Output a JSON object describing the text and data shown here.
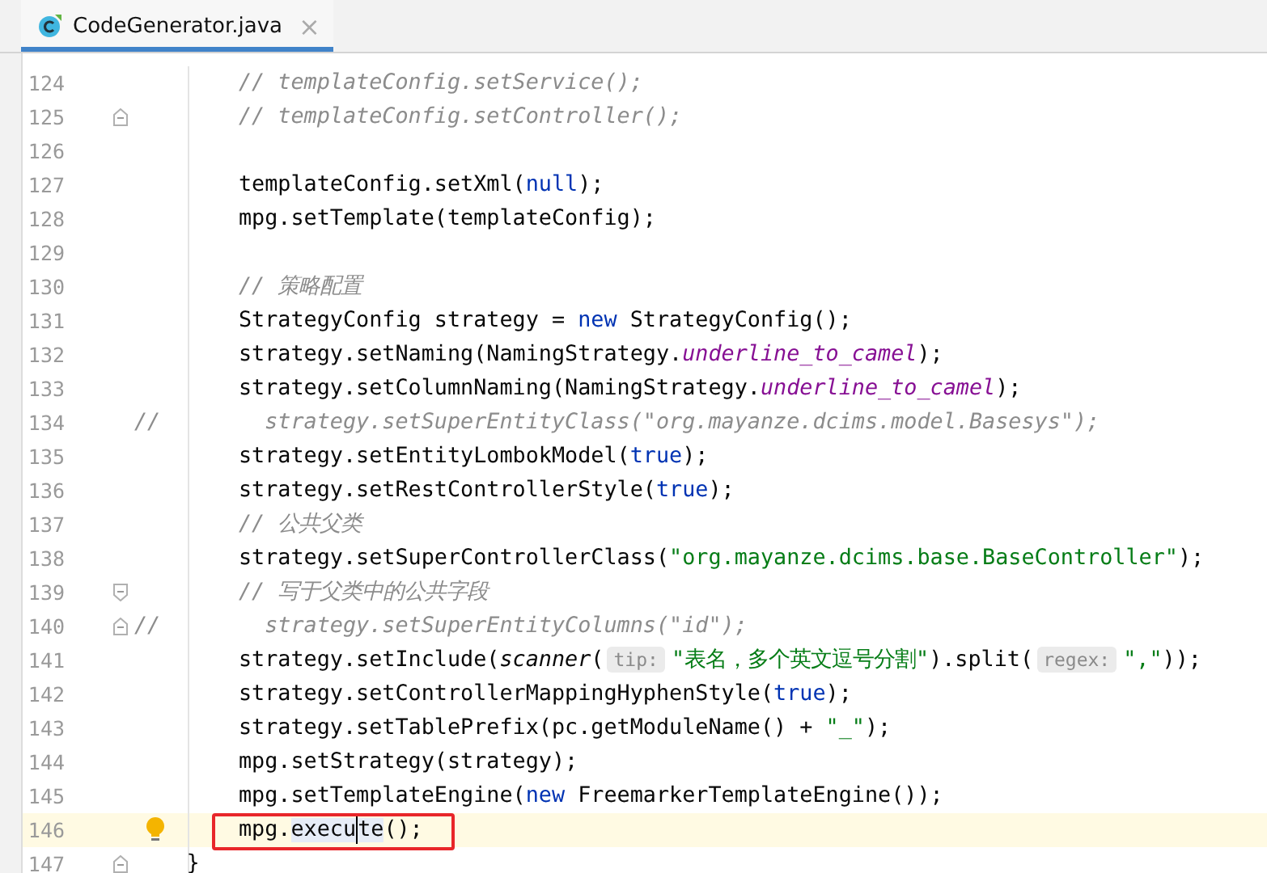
{
  "tab": {
    "title": "CodeGenerator.java",
    "selected": true,
    "close_glyph": "×"
  },
  "lines": [
    {
      "number": "124",
      "segments": [
        {
          "kind": "comment",
          "text": "        // templateConfig.setService();"
        }
      ]
    },
    {
      "number": "125",
      "fold_close": true,
      "segments": [
        {
          "kind": "comment",
          "text": "        // templateConfig.setController();"
        }
      ]
    },
    {
      "number": "126"
    },
    {
      "number": "127",
      "segments": [
        {
          "kind": "plain",
          "text": "        templateConfig.setXml("
        },
        {
          "kind": "keyword",
          "text": "null"
        },
        {
          "kind": "plain",
          "text": ");"
        }
      ]
    },
    {
      "number": "128",
      "segments": [
        {
          "kind": "plain",
          "text": "        mpg.setTemplate(templateConfig);"
        }
      ]
    },
    {
      "number": "129"
    },
    {
      "number": "130",
      "segments": [
        {
          "kind": "comment",
          "text": "        // 策略配置"
        }
      ]
    },
    {
      "number": "131",
      "segments": [
        {
          "kind": "plain",
          "text": "        StrategyConfig strategy = "
        },
        {
          "kind": "keyword",
          "text": "new"
        },
        {
          "kind": "plain",
          "text": " StrategyConfig();"
        }
      ]
    },
    {
      "number": "132",
      "segments": [
        {
          "kind": "plain",
          "text": "        strategy.setNaming(NamingStrategy."
        },
        {
          "kind": "static",
          "text": "underline_to_camel"
        },
        {
          "kind": "plain",
          "text": ");"
        }
      ]
    },
    {
      "number": "133",
      "segments": [
        {
          "kind": "plain",
          "text": "        strategy.setColumnNaming(NamingStrategy."
        },
        {
          "kind": "static",
          "text": "underline_to_camel"
        },
        {
          "kind": "plain",
          "text": ");"
        }
      ]
    },
    {
      "number": "134",
      "segments": [
        {
          "kind": "comment",
          "text": "//        strategy.setSuperEntityClass(\"org.mayanze.dcims.model.Basesys\");"
        }
      ]
    },
    {
      "number": "135",
      "segments": [
        {
          "kind": "plain",
          "text": "        strategy.setEntityLombokModel("
        },
        {
          "kind": "keyword",
          "text": "true"
        },
        {
          "kind": "plain",
          "text": ");"
        }
      ]
    },
    {
      "number": "136",
      "segments": [
        {
          "kind": "plain",
          "text": "        strategy.setRestControllerStyle("
        },
        {
          "kind": "keyword",
          "text": "true"
        },
        {
          "kind": "plain",
          "text": ");"
        }
      ]
    },
    {
      "number": "137",
      "segments": [
        {
          "kind": "comment",
          "text": "        // 公共父类"
        }
      ]
    },
    {
      "number": "138",
      "segments": [
        {
          "kind": "plain",
          "text": "        strategy.setSuperControllerClass("
        },
        {
          "kind": "string",
          "text": "\"org.mayanze.dcims.base.BaseController\""
        },
        {
          "kind": "plain",
          "text": ");"
        }
      ]
    },
    {
      "number": "139",
      "fold_open": true,
      "segments": [
        {
          "kind": "comment",
          "text": "        // 写于父类中的公共字段"
        }
      ]
    },
    {
      "number": "140",
      "fold_close": true,
      "segments": [
        {
          "kind": "comment",
          "text": "//        strategy.setSuperEntityColumns(\"id\");"
        }
      ]
    },
    {
      "number": "141",
      "segments": [
        {
          "kind": "plain",
          "text": "        strategy.setInclude("
        },
        {
          "kind": "italic",
          "text": "scanner"
        },
        {
          "kind": "plain",
          "text": "("
        },
        {
          "kind": "hint",
          "text": "tip:"
        },
        {
          "kind": "string",
          "text": "\"表名，多个英文逗号分割\""
        },
        {
          "kind": "plain",
          "text": ").split("
        },
        {
          "kind": "hint",
          "text": "regex:"
        },
        {
          "kind": "string",
          "text": "\",\""
        },
        {
          "kind": "plain",
          "text": "));"
        }
      ]
    },
    {
      "number": "142",
      "segments": [
        {
          "kind": "plain",
          "text": "        strategy.setControllerMappingHyphenStyle("
        },
        {
          "kind": "keyword",
          "text": "true"
        },
        {
          "kind": "plain",
          "text": ");"
        }
      ]
    },
    {
      "number": "143",
      "segments": [
        {
          "kind": "plain",
          "text": "        strategy.setTablePrefix(pc.getModuleName() + "
        },
        {
          "kind": "string",
          "text": "\"_\""
        },
        {
          "kind": "plain",
          "text": ");"
        }
      ]
    },
    {
      "number": "144",
      "segments": [
        {
          "kind": "plain",
          "text": "        mpg.setStrategy(strategy);"
        }
      ]
    },
    {
      "number": "145",
      "segments": [
        {
          "kind": "plain",
          "text": "        mpg.setTemplateEngine("
        },
        {
          "kind": "keyword",
          "text": "new"
        },
        {
          "kind": "plain",
          "text": " FreemarkerTemplateEngine());"
        }
      ]
    },
    {
      "number": "146",
      "current": true,
      "bulb": true,
      "boxed": true,
      "segments": [
        {
          "kind": "plain",
          "text": "        mpg."
        },
        {
          "kind": "usage",
          "text": "execu"
        },
        {
          "kind": "caret"
        },
        {
          "kind": "usage",
          "text": "te"
        },
        {
          "kind": "plain",
          "text": "();"
        }
      ]
    },
    {
      "number": "147",
      "fold_close": true,
      "segments": [
        {
          "kind": "plain",
          "text": "    }"
        }
      ]
    }
  ]
}
